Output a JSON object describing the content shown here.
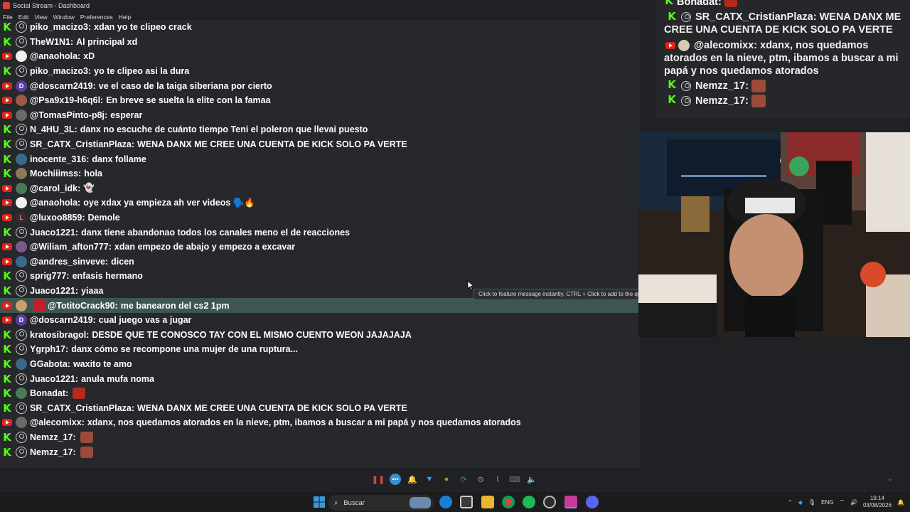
{
  "window": {
    "title": "Social Stream - Dashboard",
    "menu": [
      "File",
      "Edit",
      "View",
      "Window",
      "Preferences",
      "Help"
    ]
  },
  "chat": [
    {
      "platform": "kick",
      "avatar": "default",
      "user": "piko_macizo3:",
      "text": "xdan yo te clipeo crack"
    },
    {
      "platform": "kick",
      "avatar": "default",
      "user": "TheW1N1:",
      "text": "Al principal xd"
    },
    {
      "platform": "youtube",
      "avatar": "white",
      "user": "@anaohola:",
      "text": "xD"
    },
    {
      "platform": "kick",
      "avatar": "default",
      "user": "piko_macizo3:",
      "text": "yo te clipeo asi la dura"
    },
    {
      "platform": "youtube",
      "avatar": "D",
      "user": "@doscarn2419:",
      "text": "ve el caso de la taiga siberiana por cierto"
    },
    {
      "platform": "youtube",
      "avatar": "photo",
      "user": "@Psa9x19-h6q6l:",
      "text": "En breve se suelta la elite con la famaa"
    },
    {
      "platform": "youtube",
      "avatar": "photo",
      "user": "@TomasPinto-p8j:",
      "text": "esperar"
    },
    {
      "platform": "kick",
      "avatar": "default",
      "user": "N_4HU_3L:",
      "text": "danx no escuche de cuánto tiempo Teni el poleron que llevai puesto"
    },
    {
      "platform": "kick",
      "avatar": "default",
      "user": "SR_CATX_CristianPlaza:",
      "text": "WENA DANX ME CREE UNA CUENTA DE KICK SOLO PA VERTE"
    },
    {
      "platform": "kick",
      "avatar": "photo",
      "user": "inocente_316:",
      "text": "danx follame"
    },
    {
      "platform": "kick",
      "avatar": "photo",
      "user": "Mochiiimss:",
      "text": "hola"
    },
    {
      "platform": "youtube",
      "avatar": "photo",
      "user": "@carol_idk:",
      "text": "👻"
    },
    {
      "platform": "youtube",
      "avatar": "white",
      "user": "@anaohola:",
      "text": "oye xdax ya empieza ah ver videos 🗣️🔥"
    },
    {
      "platform": "youtube",
      "avatar": "L",
      "user": "@luxoo8859:",
      "text": "Demole"
    },
    {
      "platform": "kick",
      "avatar": "default",
      "user": "Juaco1221:",
      "text": "danx tiene abandonao todos los canales meno el de reacciones"
    },
    {
      "platform": "youtube",
      "avatar": "photo",
      "user": "@Wiliam_afton777:",
      "text": "xdan empezo de abajo y empezo a excavar"
    },
    {
      "platform": "youtube",
      "avatar": "photo",
      "user": "@andres_sinveve:",
      "text": "dicen"
    },
    {
      "platform": "kick",
      "avatar": "default",
      "user": "sprig777:",
      "text": "enfasis hermano"
    },
    {
      "platform": "kick",
      "avatar": "default",
      "user": "Juaco1221:",
      "text": "yiaaa"
    },
    {
      "platform": "youtube",
      "avatar": "photo",
      "user": "@TotitoCrack90:",
      "text": "me banearon del cs2 1pm",
      "highlight": true
    },
    {
      "platform": "youtube",
      "avatar": "D",
      "user": "@doscarn2419:",
      "text": "cual juego vas a jugar"
    },
    {
      "platform": "kick",
      "avatar": "default",
      "user": "kratosibragol:",
      "text": "DESDE QUE TE CONOSCO TAY CON EL MISMO CUENTO WEON JAJAJAJA"
    },
    {
      "platform": "kick",
      "avatar": "default",
      "user": "Ygrph17:",
      "text": "danx cómo se recompone una mujer de una ruptura..."
    },
    {
      "platform": "kick",
      "avatar": "photo",
      "user": "GGabota:",
      "text": "waxito te amo"
    },
    {
      "platform": "kick",
      "avatar": "default",
      "user": "Juaco1221:",
      "text": "anula mufa noma"
    },
    {
      "platform": "kick",
      "avatar": "photo",
      "user": "Bonadat:",
      "text": "",
      "emote": "#b42a1e"
    },
    {
      "platform": "kick",
      "avatar": "default",
      "user": "SR_CATX_CristianPlaza:",
      "text": "WENA DANX ME CREE UNA CUENTA DE KICK SOLO PA VERTE"
    },
    {
      "platform": "youtube",
      "avatar": "photo",
      "user": "@alecomixx:",
      "text": "xdanx, nos quedamos atorados en la nieve, ptm, ibamos a buscar a mi papá y nos quedamos atorados"
    },
    {
      "platform": "kick",
      "avatar": "default",
      "user": "Nemzz_17:",
      "text": "",
      "emote": "#9c4a3a"
    },
    {
      "platform": "kick",
      "avatar": "default",
      "user": "Nemzz_17:",
      "text": "",
      "emote": "#9c4a3a"
    }
  ],
  "tooltip": "Click to feature message instantly. CTRL + Click to add to the qu",
  "overlay": {
    "partial_top": "Bonadat:",
    "messages": [
      {
        "platform": "kick",
        "user": "SR_CATX_CristianPlaza:",
        "text": "WENA DANX ME CREE UNA CUENTA DE KICK SOLO PA VERTE"
      },
      {
        "platform": "youtube",
        "user": "@alecomixx:",
        "text": "xdanx, nos quedamos atorados en la nieve, ptm, ibamos a buscar a mi papá y nos quedamos atorados"
      },
      {
        "platform": "kick",
        "user": "Nemzz_17:",
        "text": ""
      },
      {
        "platform": "kick",
        "user": "Nemzz_17:",
        "text": ""
      }
    ]
  },
  "taskbar": {
    "search_placeholder": "Buscar",
    "language": "ENG",
    "time": "19:14",
    "date": "03/08/2026"
  }
}
